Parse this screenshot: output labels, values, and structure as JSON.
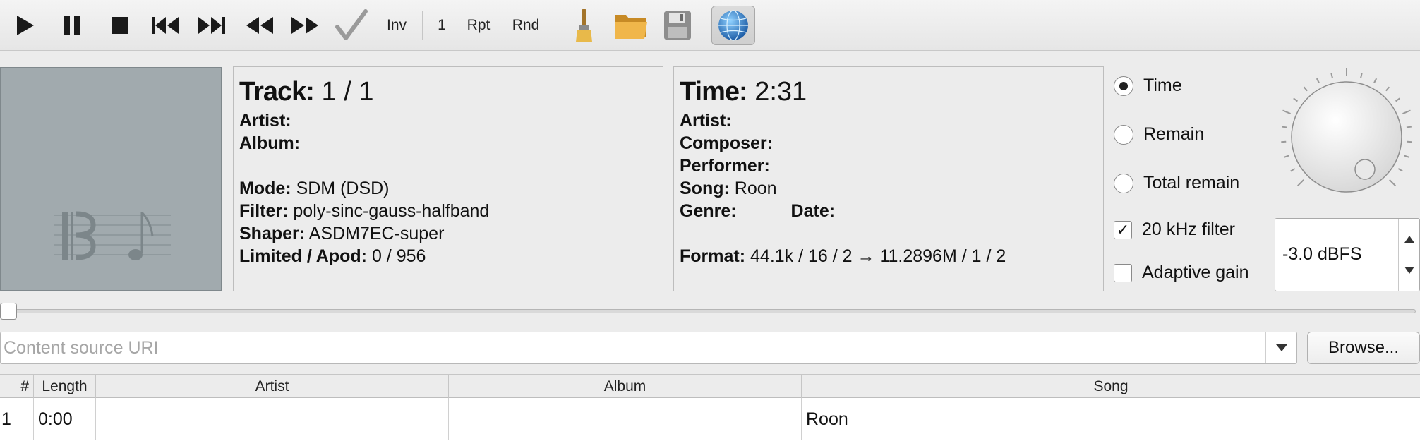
{
  "toolbar": {
    "play_icon": "play-icon",
    "pause_icon": "pause-icon",
    "stop_icon": "stop-icon",
    "prev_icon": "skip-previous-icon",
    "next_icon": "skip-next-icon",
    "rewind_icon": "rewind-icon",
    "forward_icon": "fast-forward-icon",
    "check_icon": "checkmark-icon",
    "inv_label": "Inv",
    "one_label": "1",
    "rpt_label": "Rpt",
    "rnd_label": "Rnd",
    "clear_icon": "brush-icon",
    "open_icon": "folder-icon",
    "save_icon": "floppy-disk-icon",
    "network_icon": "globe-icon"
  },
  "track_panel": {
    "track_label": "Track:",
    "track_value": "1 / 1",
    "artist_label": "Artist:",
    "artist_value": "",
    "album_label": "Album:",
    "album_value": "",
    "mode_label": "Mode:",
    "mode_value": "SDM (DSD)",
    "filter_label": "Filter:",
    "filter_value": "poly-sinc-gauss-halfband",
    "shaper_label": "Shaper:",
    "shaper_value": "ASDM7EC-super",
    "limited_label": "Limited / Apod:",
    "limited_value": "0 / 956"
  },
  "time_panel": {
    "time_label": "Time:",
    "time_value": "2:31",
    "artist_label": "Artist:",
    "composer_label": "Composer:",
    "performer_label": "Performer:",
    "song_label": "Song:",
    "song_value": "Roon",
    "genre_label": "Genre:",
    "date_label": "Date:",
    "format_label": "Format:",
    "format_value": "44.1k / 16 / 2 → 11.2896M / 1 / 2"
  },
  "display_mode": {
    "options": [
      "Time",
      "Remain",
      "Total remain"
    ],
    "selected": "Time"
  },
  "filters": {
    "khz_filter_label": "20 kHz filter",
    "khz_filter_checked": true,
    "adaptive_gain_label": "Adaptive gain",
    "adaptive_gain_checked": false
  },
  "volume": {
    "gain_value": "-3.0 dBFS"
  },
  "seek": {
    "position": 0.0
  },
  "source": {
    "placeholder": "Content source URI",
    "value": "",
    "browse_label": "Browse..."
  },
  "playlist": {
    "columns": [
      "#",
      "Length",
      "Artist",
      "Album",
      "Song"
    ],
    "rows": [
      {
        "num": "1",
        "length": "0:00",
        "artist": "",
        "album": "",
        "song": "Roon"
      }
    ]
  },
  "colors": {
    "accent_globe": "#2f86c9",
    "folder": "#e0a53a",
    "album_art_bg": "#a1aaae"
  }
}
